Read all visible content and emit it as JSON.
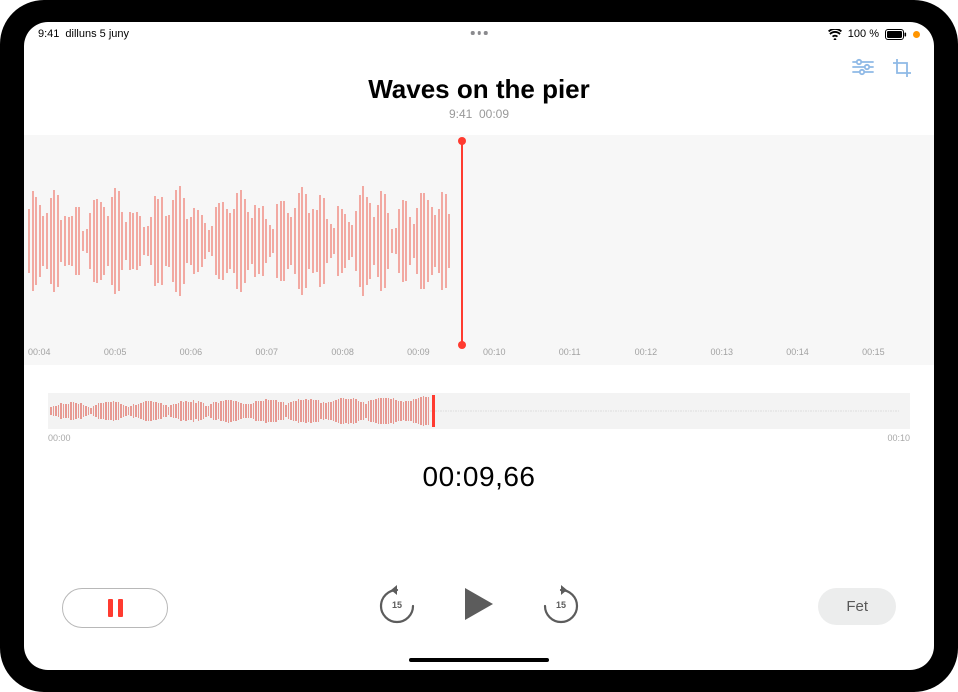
{
  "status": {
    "time": "9:41",
    "date": "dilluns 5 juny",
    "battery": "100 %"
  },
  "toolbar": {
    "adjust_icon": "sliders-icon",
    "crop_icon": "crop-icon"
  },
  "recording": {
    "title": "Waves on the pier",
    "meta_time": "9:41",
    "meta_duration": "00:09"
  },
  "timeline_ticks": [
    "00:04",
    "00:05",
    "00:06",
    "00:07",
    "00:08",
    "00:09",
    "00:10",
    "00:11",
    "00:12",
    "00:13",
    "00:14",
    "00:15"
  ],
  "mini": {
    "start_label": "00:00",
    "end_label": "00:10"
  },
  "counter": "00:09,66",
  "controls": {
    "skip_back_label": "15",
    "skip_fwd_label": "15",
    "done_label": "Fet"
  }
}
